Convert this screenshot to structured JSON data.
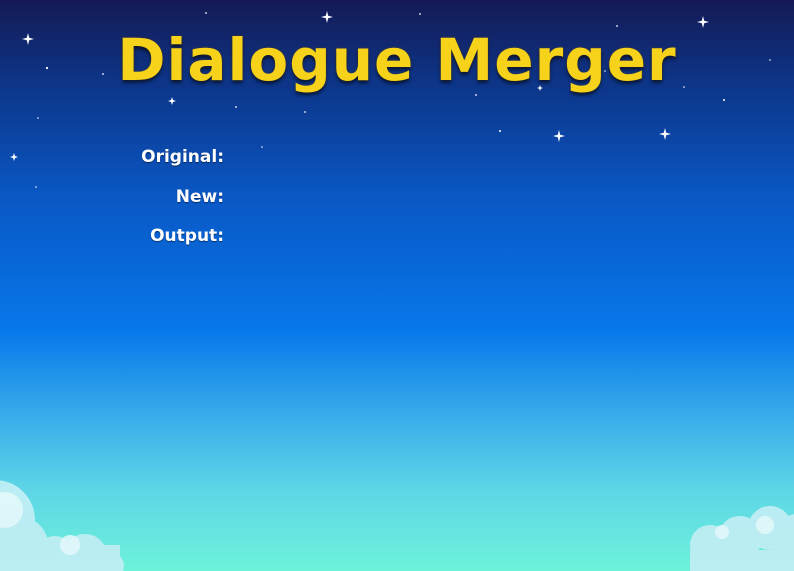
{
  "app": {
    "title": "Dialogue Merger"
  },
  "fields": {
    "original_label": "Original:",
    "new_label": "New:",
    "output_label": "Output:"
  },
  "colors": {
    "title": "#f6d21a",
    "sky_top": "#151a55",
    "sky_mid": "#0778ea",
    "sky_bottom": "#6df2da",
    "label": "#ffffff"
  }
}
